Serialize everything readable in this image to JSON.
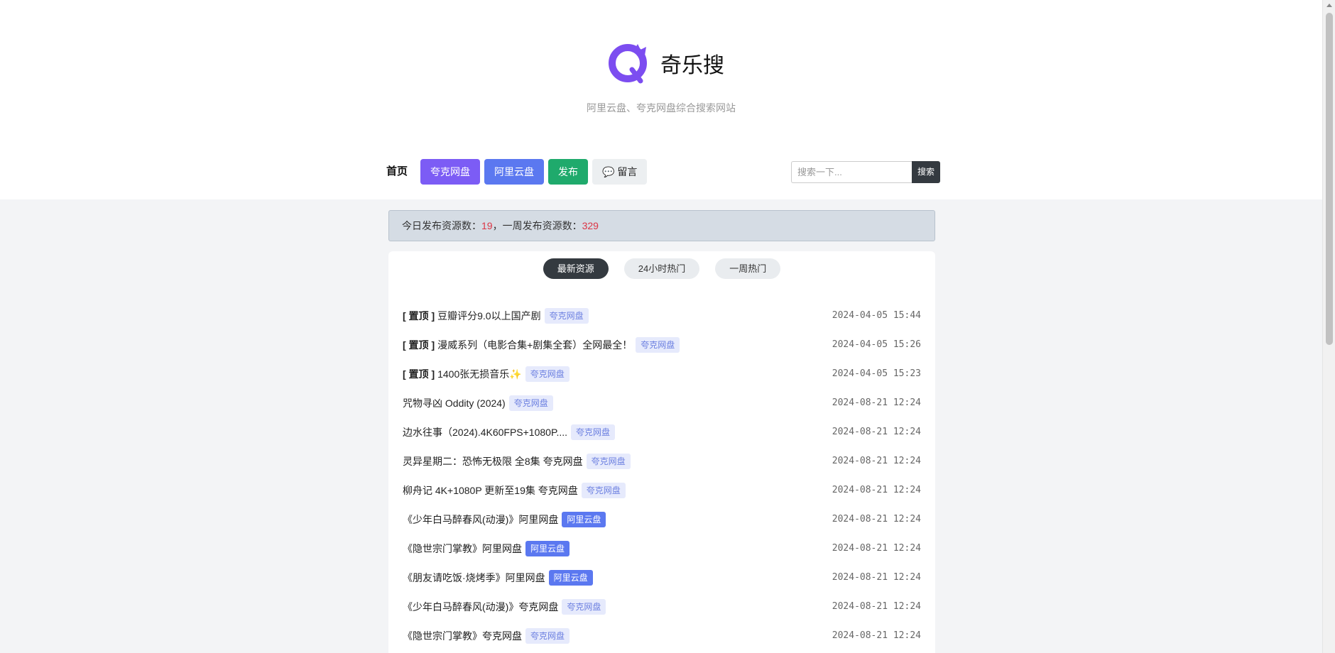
{
  "site": {
    "name": "奇乐搜",
    "tagline": "阿里云盘、夸克网盘综合搜索网站",
    "brand_color": "#7c4df0"
  },
  "nav": {
    "home": "首页",
    "quark": "夸克网盘",
    "ali": "阿里云盘",
    "publish": "发布",
    "message": "留言",
    "message_icon": "speech-bubble-icon"
  },
  "search": {
    "placeholder": "搜索一下...",
    "button": "搜索"
  },
  "stats": {
    "today_label": "今日发布资源数：",
    "today_count": "19",
    "separator": "，",
    "week_label": "一周发布资源数：",
    "week_count": "329"
  },
  "tabs": [
    {
      "label": "最新资源",
      "active": true
    },
    {
      "label": "24小时热门",
      "active": false
    },
    {
      "label": "一周热门",
      "active": false
    }
  ],
  "resources": [
    {
      "pin": "[ 置顶 ]",
      "title": "豆瓣评分9.0以上国产剧",
      "tag": "夸克网盘",
      "tag_type": "quark",
      "date": "2024-04-05 15:44"
    },
    {
      "pin": "[ 置顶 ]",
      "title": "漫威系列（电影合集+剧集全套）全网最全！",
      "tag": "夸克网盘",
      "tag_type": "quark",
      "date": "2024-04-05 15:26"
    },
    {
      "pin": "[ 置顶 ]",
      "title": "1400张无损音乐✨",
      "tag": "夸克网盘",
      "tag_type": "quark",
      "date": "2024-04-05 15:23"
    },
    {
      "pin": "",
      "title": "咒物寻凶 Oddity (2024)",
      "tag": "夸克网盘",
      "tag_type": "quark",
      "date": "2024-08-21 12:24"
    },
    {
      "pin": "",
      "title": "边水往事（2024).4K60FPS+1080P....",
      "tag": "夸克网盘",
      "tag_type": "quark",
      "date": "2024-08-21 12:24"
    },
    {
      "pin": "",
      "title": "灵异星期二：恐怖无极限 全8集 夸克网盘",
      "tag": "夸克网盘",
      "tag_type": "quark",
      "date": "2024-08-21 12:24"
    },
    {
      "pin": "",
      "title": "柳舟记 4K+1080P 更新至19集 夸克网盘",
      "tag": "夸克网盘",
      "tag_type": "quark",
      "date": "2024-08-21 12:24"
    },
    {
      "pin": "",
      "title": "《少年白马醉春风(动漫)》阿里网盘",
      "tag": "阿里云盘",
      "tag_type": "ali",
      "date": "2024-08-21 12:24"
    },
    {
      "pin": "",
      "title": "《隐世宗门掌教》阿里网盘",
      "tag": "阿里云盘",
      "tag_type": "ali",
      "date": "2024-08-21 12:24"
    },
    {
      "pin": "",
      "title": "《朋友请吃饭·烧烤季》阿里网盘",
      "tag": "阿里云盘",
      "tag_type": "ali",
      "date": "2024-08-21 12:24"
    },
    {
      "pin": "",
      "title": "《少年白马醉春风(动漫)》夸克网盘",
      "tag": "夸克网盘",
      "tag_type": "quark",
      "date": "2024-08-21 12:24"
    },
    {
      "pin": "",
      "title": "《隐世宗门掌教》夸克网盘",
      "tag": "夸克网盘",
      "tag_type": "quark",
      "date": "2024-08-21 12:24"
    }
  ]
}
